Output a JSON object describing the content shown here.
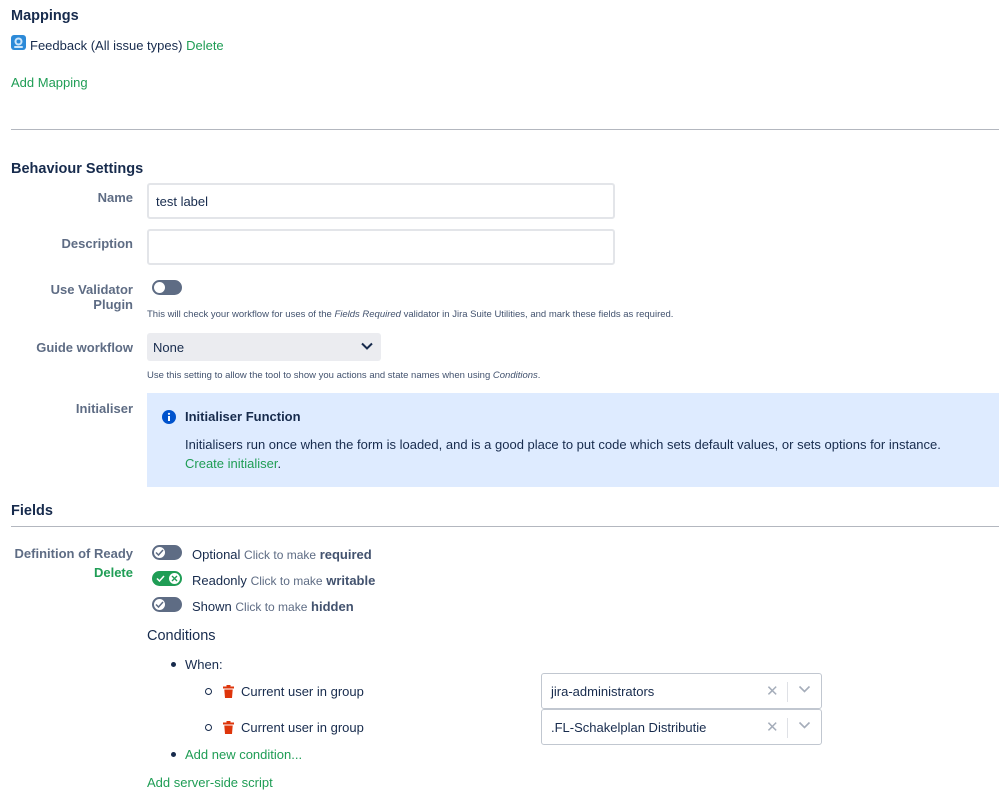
{
  "mappings": {
    "heading": "Mappings",
    "item_label": "Feedback (All issue types)",
    "delete_label": "Delete",
    "add_mapping_label": "Add Mapping"
  },
  "behaviour": {
    "heading": "Behaviour Settings",
    "name_label": "Name",
    "name_value": "test label",
    "description_label": "Description",
    "description_value": "",
    "validator_label": "Use Validator Plugin",
    "validator_enabled": false,
    "validator_help_pre": "This will check your workflow for uses of the ",
    "validator_help_em": "Fields Required",
    "validator_help_post": " validator in Jira Suite Utilities, and mark these fields as required.",
    "guide_label": "Guide workflow",
    "guide_value": "None",
    "guide_help_pre": "Use this setting to allow the tool to show you actions and state names when using ",
    "guide_help_em": "Conditions",
    "guide_help_post": ".",
    "initialiser_label": "Initialiser",
    "initialiser_title": "Initialiser Function",
    "initialiser_text": "Initialisers run once when the form is loaded, and is a good place to put code which sets default values, or sets options for instance.",
    "initialiser_link": "Create initialiser",
    "initialiser_link_suffix": ".",
    "info_color": "#0052cc",
    "accent_color": "#1f9d55"
  },
  "fields": {
    "heading": "Fields",
    "field_name": "Definition of Ready",
    "field_delete": "Delete",
    "toggles": [
      {
        "state": "Optional",
        "hint": "Click to make",
        "action": "required",
        "on": false
      },
      {
        "state": "Readonly",
        "hint": "Click to make",
        "action": "writable",
        "on": true
      },
      {
        "state": "Shown",
        "hint": "Click to make",
        "action": "hidden",
        "on": false
      }
    ],
    "conditions_heading": "Conditions",
    "when_label": "When:",
    "conditions": [
      {
        "label": "Current user in group",
        "value": "jira-administrators"
      },
      {
        "label": "Current user in group",
        "value": ".FL-Schakelplan Distributie"
      }
    ],
    "add_condition_label": "Add new condition...",
    "add_script_label": "Add server-side script"
  }
}
